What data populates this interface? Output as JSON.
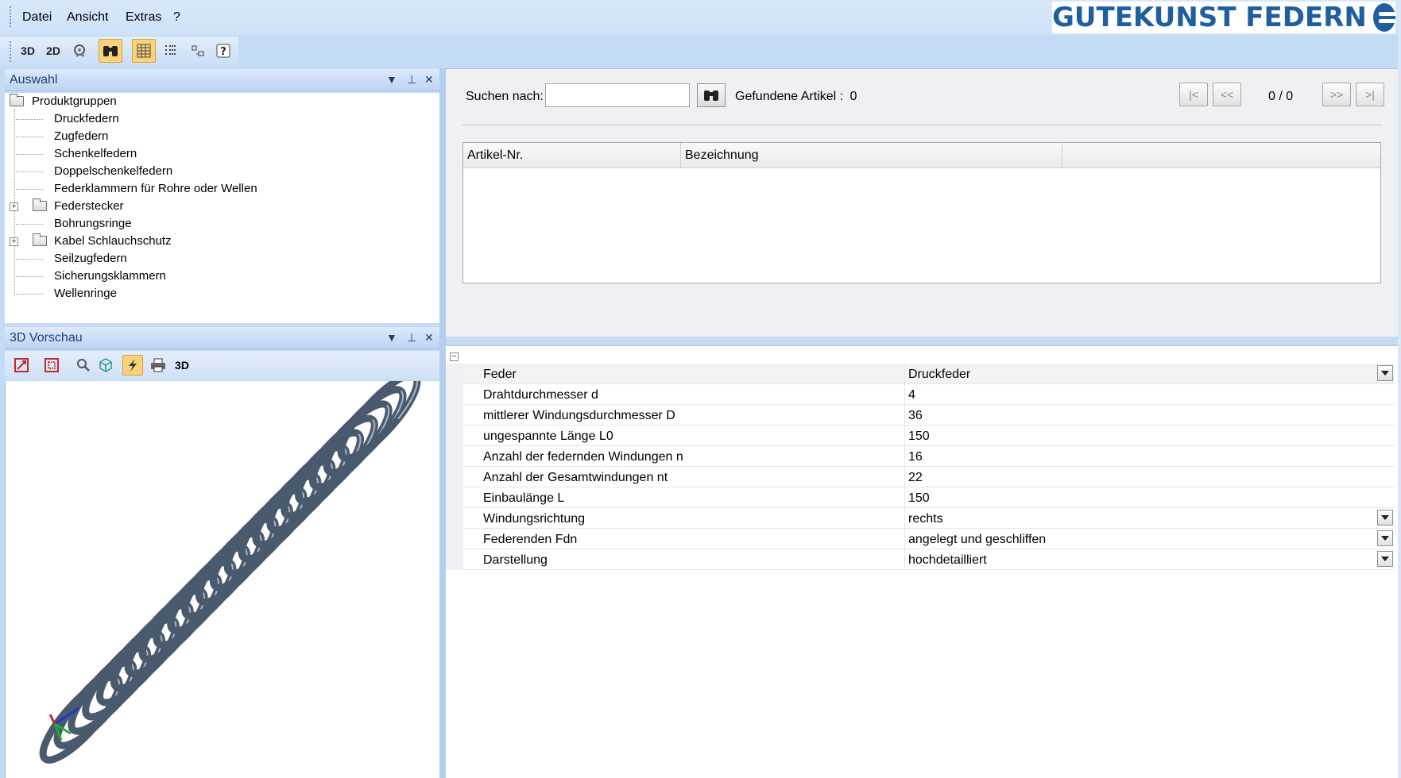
{
  "menu": [
    "Datei",
    "Ansicht",
    "Extras",
    "?"
  ],
  "logo": "GUTEKUNST FEDERN",
  "toolbar": {
    "btn_3d": "3D",
    "btn_2d": "2D",
    "icons": [
      "spring-settings-icon",
      "binoculars-icon",
      "table-view-icon",
      "list-view-icon",
      "dimension-icon",
      "help-icon"
    ]
  },
  "selection_panel": {
    "title": "Auswahl",
    "root": "Produktgruppen",
    "items": [
      {
        "label": "Druckfedern",
        "folder": false
      },
      {
        "label": "Zugfedern",
        "folder": false
      },
      {
        "label": "Schenkelfedern",
        "folder": false
      },
      {
        "label": "Doppelschenkelfedern",
        "folder": false
      },
      {
        "label": "Federklammern für Rohre oder Wellen",
        "folder": false
      },
      {
        "label": "Federstecker",
        "folder": true
      },
      {
        "label": "Bohrungsringe",
        "folder": false
      },
      {
        "label": "Kabel Schlauchschutz",
        "folder": true
      },
      {
        "label": "Seilzugfedern",
        "folder": false
      },
      {
        "label": "Sicherungsklammern",
        "folder": false
      },
      {
        "label": "Wellenringe",
        "folder": false
      }
    ]
  },
  "preview_panel": {
    "title": "3D Vorschau",
    "btn_3d": "3D"
  },
  "search": {
    "label": "Suchen nach:",
    "value": "",
    "found_label": "Gefundene Artikel :",
    "found_count": "0",
    "page_counter": "0 / 0",
    "nav": [
      "|<",
      "<<",
      ">>",
      ">|"
    ],
    "columns": [
      "Artikel-Nr.",
      "Bezeichnung",
      ""
    ]
  },
  "properties": [
    {
      "name": "Feder",
      "value": "Druckfeder",
      "dropdown": true
    },
    {
      "name": "Drahtdurchmesser d",
      "value": "4",
      "dropdown": false
    },
    {
      "name": "mittlerer Windungsdurchmesser D",
      "value": "36",
      "dropdown": false
    },
    {
      "name": "ungespannte Länge L0",
      "value": "150",
      "dropdown": false
    },
    {
      "name": "Anzahl der federnden Windungen n",
      "value": "16",
      "dropdown": false
    },
    {
      "name": "Anzahl der Gesamtwindungen nt",
      "value": "22",
      "dropdown": false
    },
    {
      "name": "Einbaulänge L",
      "value": "150",
      "dropdown": false
    },
    {
      "name": "Windungsrichtung",
      "value": "rechts",
      "dropdown": true
    },
    {
      "name": "Federenden Fdn",
      "value": "angelegt und geschliffen",
      "dropdown": true
    },
    {
      "name": "Darstellung",
      "value": "hochdetailliert",
      "dropdown": true
    }
  ],
  "colors": {
    "chrome": "#c4dbf5",
    "brand": "#1f5fa0",
    "active_button": "#f9d27a",
    "spring": "#4a5a6e"
  }
}
